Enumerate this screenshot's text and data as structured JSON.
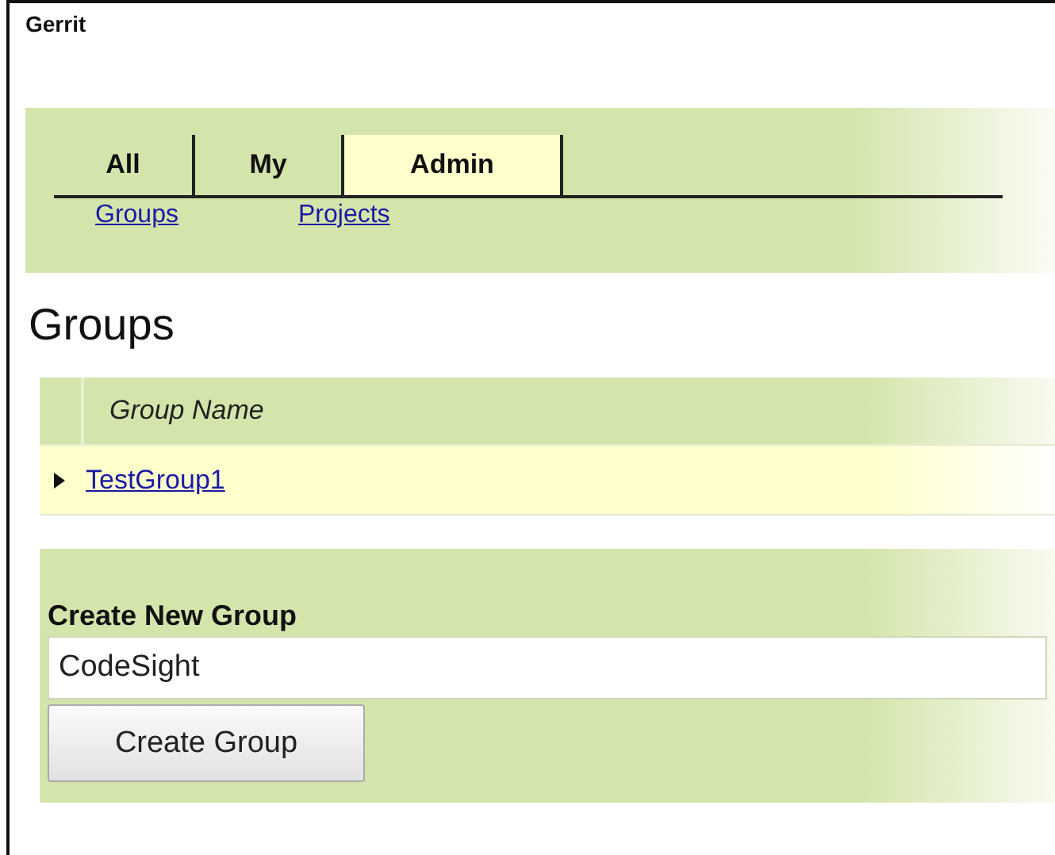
{
  "header": {
    "title": "Gerrit"
  },
  "tabs": [
    {
      "label": "All",
      "selected": false
    },
    {
      "label": "My",
      "selected": false
    },
    {
      "label": "Admin",
      "selected": true
    }
  ],
  "subnav": [
    {
      "label": "Groups"
    },
    {
      "label": "Projects"
    }
  ],
  "page_title": "Groups",
  "table": {
    "columns": [
      "Group Name"
    ],
    "rows": [
      {
        "name": "TestGroup1",
        "expanded": false
      }
    ]
  },
  "create_group": {
    "title": "Create New Group",
    "input": {
      "value": "CodeSight"
    },
    "button": "Create Group"
  }
}
